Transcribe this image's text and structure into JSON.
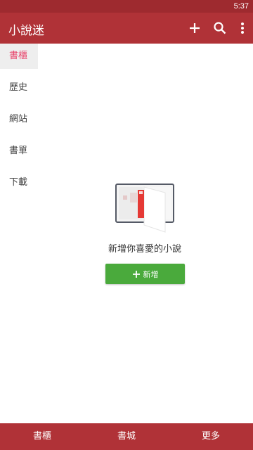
{
  "status_bar": {
    "time": "5:37"
  },
  "app_bar": {
    "title": "小說迷",
    "actions": [
      "add-icon",
      "search-icon",
      "more-vert-icon"
    ]
  },
  "sidebar": {
    "items": [
      {
        "label": "書櫃",
        "active": true
      },
      {
        "label": "歷史",
        "active": false
      },
      {
        "label": "網站",
        "active": false
      },
      {
        "label": "書單",
        "active": false
      },
      {
        "label": "下載",
        "active": false
      }
    ]
  },
  "empty_state": {
    "illustration": "open-book-icon",
    "message": "新增你喜愛的小說",
    "button_label": "新增"
  },
  "bottom_nav": {
    "tabs": [
      {
        "label": "書櫃"
      },
      {
        "label": "書城"
      },
      {
        "label": "更多"
      }
    ]
  },
  "colors": {
    "status_bar": "#9e2a2f",
    "primary": "#b03237",
    "active_text": "#e8446b",
    "button": "#4aaa3c"
  }
}
